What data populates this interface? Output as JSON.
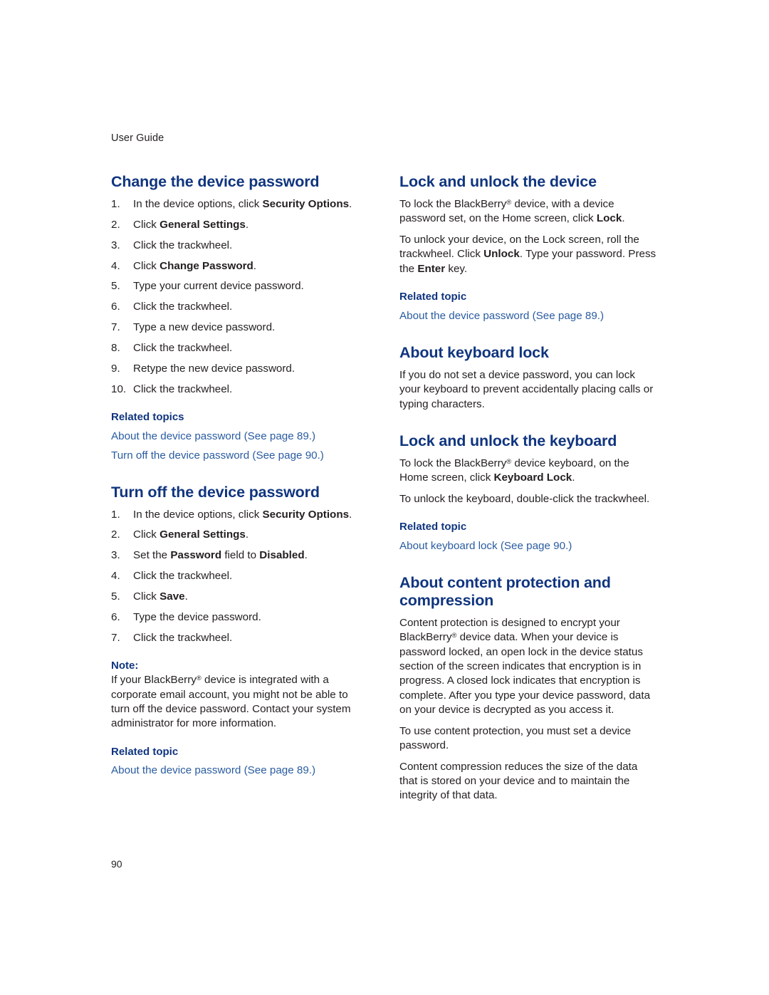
{
  "page": {
    "running_head": "User Guide",
    "folio": "90",
    "heading_color": "#10357f",
    "link_color": "#2a5ca0",
    "body_color": "#231f20"
  },
  "left_column": {
    "sections": [
      {
        "title": "Change the device password",
        "steps": [
          {
            "num": "1.",
            "parts": [
              {
                "t": "In the device options, click ",
                "b": false
              },
              {
                "t": "Security Options",
                "b": true
              },
              {
                "t": ".",
                "b": false
              }
            ]
          },
          {
            "num": "2.",
            "parts": [
              {
                "t": "Click ",
                "b": false
              },
              {
                "t": "General Settings",
                "b": true
              },
              {
                "t": ".",
                "b": false
              }
            ]
          },
          {
            "num": "3.",
            "parts": [
              {
                "t": "Click the trackwheel.",
                "b": false
              }
            ]
          },
          {
            "num": "4.",
            "parts": [
              {
                "t": "Click ",
                "b": false
              },
              {
                "t": "Change Password",
                "b": true
              },
              {
                "t": ".",
                "b": false
              }
            ]
          },
          {
            "num": "5.",
            "parts": [
              {
                "t": "Type your current device password.",
                "b": false
              }
            ]
          },
          {
            "num": "6.",
            "parts": [
              {
                "t": "Click the trackwheel.",
                "b": false
              }
            ]
          },
          {
            "num": "7.",
            "parts": [
              {
                "t": "Type a new device password.",
                "b": false
              }
            ]
          },
          {
            "num": "8.",
            "parts": [
              {
                "t": "Click the trackwheel.",
                "b": false
              }
            ]
          },
          {
            "num": "9.",
            "parts": [
              {
                "t": "Retype the new device password.",
                "b": false
              }
            ]
          },
          {
            "num": "10.",
            "parts": [
              {
                "t": "Click the trackwheel.",
                "b": false
              }
            ]
          }
        ],
        "related_label": "Related topics",
        "related_links": [
          "About the device password (See page 89.)",
          "Turn off the device password (See page 90.)"
        ]
      },
      {
        "title": "Turn off the device password",
        "steps": [
          {
            "num": "1.",
            "parts": [
              {
                "t": "In the device options, click ",
                "b": false
              },
              {
                "t": "Security Options",
                "b": true
              },
              {
                "t": ".",
                "b": false
              }
            ]
          },
          {
            "num": "2.",
            "parts": [
              {
                "t": "Click ",
                "b": false
              },
              {
                "t": "General Settings",
                "b": true
              },
              {
                "t": ".",
                "b": false
              }
            ]
          },
          {
            "num": "3.",
            "parts": [
              {
                "t": "Set the ",
                "b": false
              },
              {
                "t": "Password",
                "b": true
              },
              {
                "t": " field to ",
                "b": false
              },
              {
                "t": "Disabled",
                "b": true
              },
              {
                "t": ".",
                "b": false
              }
            ]
          },
          {
            "num": "4.",
            "parts": [
              {
                "t": "Click the trackwheel.",
                "b": false
              }
            ]
          },
          {
            "num": "5.",
            "parts": [
              {
                "t": "Click ",
                "b": false
              },
              {
                "t": "Save",
                "b": true
              },
              {
                "t": ".",
                "b": false
              }
            ]
          },
          {
            "num": "6.",
            "parts": [
              {
                "t": "Type the device password.",
                "b": false
              }
            ]
          },
          {
            "num": "7.",
            "parts": [
              {
                "t": "Click the trackwheel.",
                "b": false
              }
            ]
          }
        ],
        "note_label": "Note:",
        "note_body_parts": [
          {
            "t": "If your BlackBerry",
            "b": false
          },
          {
            "t": "®",
            "reg": true
          },
          {
            "t": " device is integrated with a corporate email account, you might not be able to turn off the device password. Contact your system administrator for more information.",
            "b": false
          }
        ],
        "related_label": "Related topic",
        "related_links": [
          "About the device password (See page 89.)"
        ]
      }
    ]
  },
  "right_column": {
    "sections": [
      {
        "title": "Lock and unlock the device",
        "paragraphs": [
          [
            {
              "t": "To lock the BlackBerry",
              "b": false
            },
            {
              "t": "®",
              "reg": true
            },
            {
              "t": " device, with a device password set, on the Home screen, click ",
              "b": false
            },
            {
              "t": "Lock",
              "b": true
            },
            {
              "t": ".",
              "b": false
            }
          ],
          [
            {
              "t": "To unlock your device, on the Lock screen, roll the trackwheel. Click ",
              "b": false
            },
            {
              "t": "Unlock",
              "b": true
            },
            {
              "t": ". Type your password. Press the ",
              "b": false
            },
            {
              "t": "Enter",
              "b": true
            },
            {
              "t": " key.",
              "b": false
            }
          ]
        ],
        "related_label": "Related topic",
        "related_links": [
          "About the device password (See page 89.)"
        ]
      },
      {
        "title": "About keyboard lock",
        "paragraphs": [
          [
            {
              "t": "If you do not set a device password, you can lock your keyboard to prevent accidentally placing calls or typing characters.",
              "b": false
            }
          ]
        ],
        "related_label": "",
        "related_links": []
      },
      {
        "title": "Lock and unlock the keyboard",
        "paragraphs": [
          [
            {
              "t": "To lock the BlackBerry",
              "b": false
            },
            {
              "t": "®",
              "reg": true
            },
            {
              "t": " device keyboard, on the Home screen, click ",
              "b": false
            },
            {
              "t": "Keyboard Lock",
              "b": true
            },
            {
              "t": ".",
              "b": false
            }
          ],
          [
            {
              "t": "To unlock the keyboard, double-click the trackwheel.",
              "b": false
            }
          ]
        ],
        "related_label": "Related topic",
        "related_links": [
          "About keyboard lock (See page 90.)"
        ]
      },
      {
        "title": "About content protection and compression",
        "paragraphs": [
          [
            {
              "t": "Content protection is designed to encrypt your BlackBerry",
              "b": false
            },
            {
              "t": "®",
              "reg": true
            },
            {
              "t": " device data. When your device is password locked, an open lock in the device status section of the screen indicates that encryption is in progress. A closed lock indicates that encryption is complete. After you type your device password, data on your device is decrypted as you access it.",
              "b": false
            }
          ],
          [
            {
              "t": "To use content protection, you must set a device password.",
              "b": false
            }
          ],
          [
            {
              "t": "Content compression reduces the size of the data that is stored on your device and to maintain the integrity of that data.",
              "b": false
            }
          ]
        ],
        "related_label": "",
        "related_links": []
      }
    ]
  }
}
